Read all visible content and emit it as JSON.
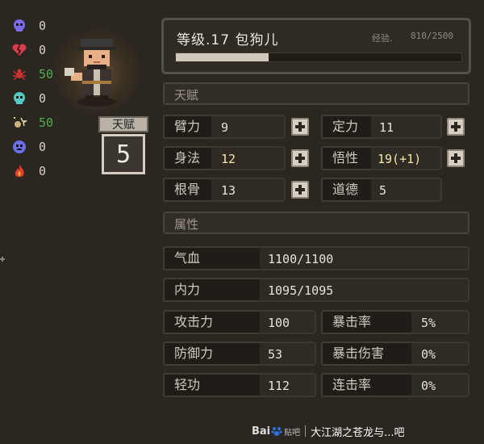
{
  "status_effects": [
    {
      "icon": "skull-icon",
      "color": "#7b6cf0",
      "value": "0",
      "value_color": "#d8d2c6"
    },
    {
      "icon": "broken-heart-icon",
      "color": "#d83e4d",
      "value": "0",
      "value_color": "#d8d2c6"
    },
    {
      "icon": "spider-icon",
      "color": "#c9322f",
      "value": "50",
      "value_color": "#4bb24b"
    },
    {
      "icon": "cyan-skull-icon",
      "color": "#55c9c4",
      "value": "0",
      "value_color": "#d8d2c6"
    },
    {
      "icon": "dizzy-icon",
      "color": "#c8b47a",
      "value": "50",
      "value_color": "#4bb24b"
    },
    {
      "icon": "purple-skull-icon",
      "color": "#6b6ff2",
      "value": "0",
      "value_color": "#d8d2c6"
    },
    {
      "icon": "flame-icon",
      "color": "#e0412c",
      "value": "0",
      "value_color": "#d8d2c6"
    }
  ],
  "talent_box": {
    "title": "天赋",
    "points": "5"
  },
  "header": {
    "level_text": "等级.17 包狗儿",
    "exp_label": "经验.",
    "exp_value": "810/2500",
    "exp_fraction": 0.324
  },
  "sections": {
    "talent": "天赋",
    "attributes": "属性"
  },
  "talents": [
    {
      "label": "臂力",
      "value": "9",
      "gold": false
    },
    {
      "label": "定力",
      "value": "11",
      "gold": false
    },
    {
      "label": "身法",
      "value": "12",
      "gold": true
    },
    {
      "label": "悟性",
      "value": "19(+1)",
      "gold": true
    },
    {
      "label": "根骨",
      "value": "13",
      "gold": false
    },
    {
      "label": "道德",
      "value": "5",
      "gold": false
    }
  ],
  "attributes": {
    "hp": {
      "label": "气血",
      "value": "1100/1100"
    },
    "mp": {
      "label": "内力",
      "value": "1095/1095"
    },
    "atk": {
      "label": "攻击力",
      "value": "100"
    },
    "crit_rate": {
      "label": "暴击率",
      "value": "5%"
    },
    "def": {
      "label": "防御力",
      "value": "53"
    },
    "crit_dmg": {
      "label": "暴击伤害",
      "value": "0%"
    },
    "qinggong": {
      "label": "轻功",
      "value": "112"
    },
    "combo": {
      "label": "连击率",
      "value": "0%"
    }
  },
  "watermark": {
    "logo": "Bai",
    "logo_tail": "贴吧",
    "text": "大江湖之苍龙与...吧"
  }
}
